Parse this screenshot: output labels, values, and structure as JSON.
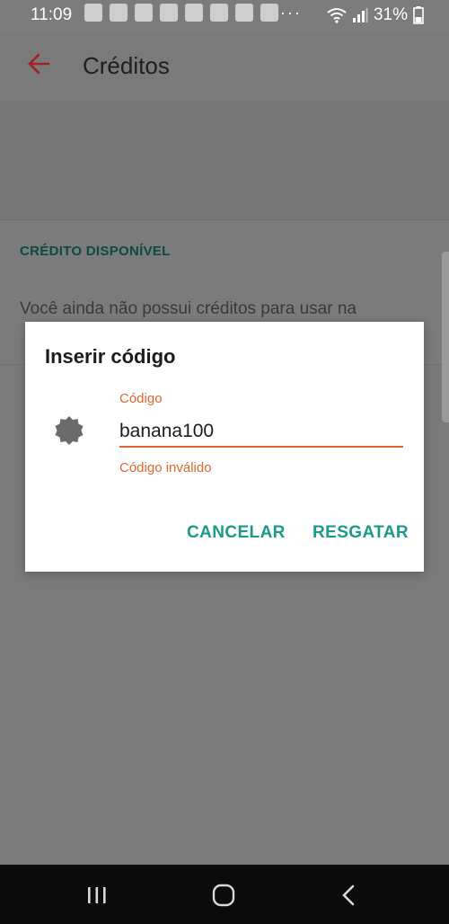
{
  "status_bar": {
    "time": "11:09",
    "more": "···",
    "battery": "31%"
  },
  "app_bar": {
    "title": "Créditos"
  },
  "credit_section": {
    "title": "CRÉDITO DISPONÍVEL",
    "message": "Você ainda não possui créditos para usar na"
  },
  "dialog": {
    "title": "Inserir código",
    "field_label": "Código",
    "field_value": "banana100",
    "field_error": "Código inválido",
    "cancel_label": "CANCELAR",
    "redeem_label": "RESGATAR"
  },
  "icons": {
    "back": "arrow-left-icon",
    "code": "gear-badge-icon",
    "nav_recent": "recent-apps-icon",
    "nav_home": "home-icon",
    "nav_back": "chevron-left-icon"
  },
  "colors": {
    "accent_red": "#c62828",
    "accent_teal": "#1a9a88",
    "error_orange": "#e0662b"
  }
}
